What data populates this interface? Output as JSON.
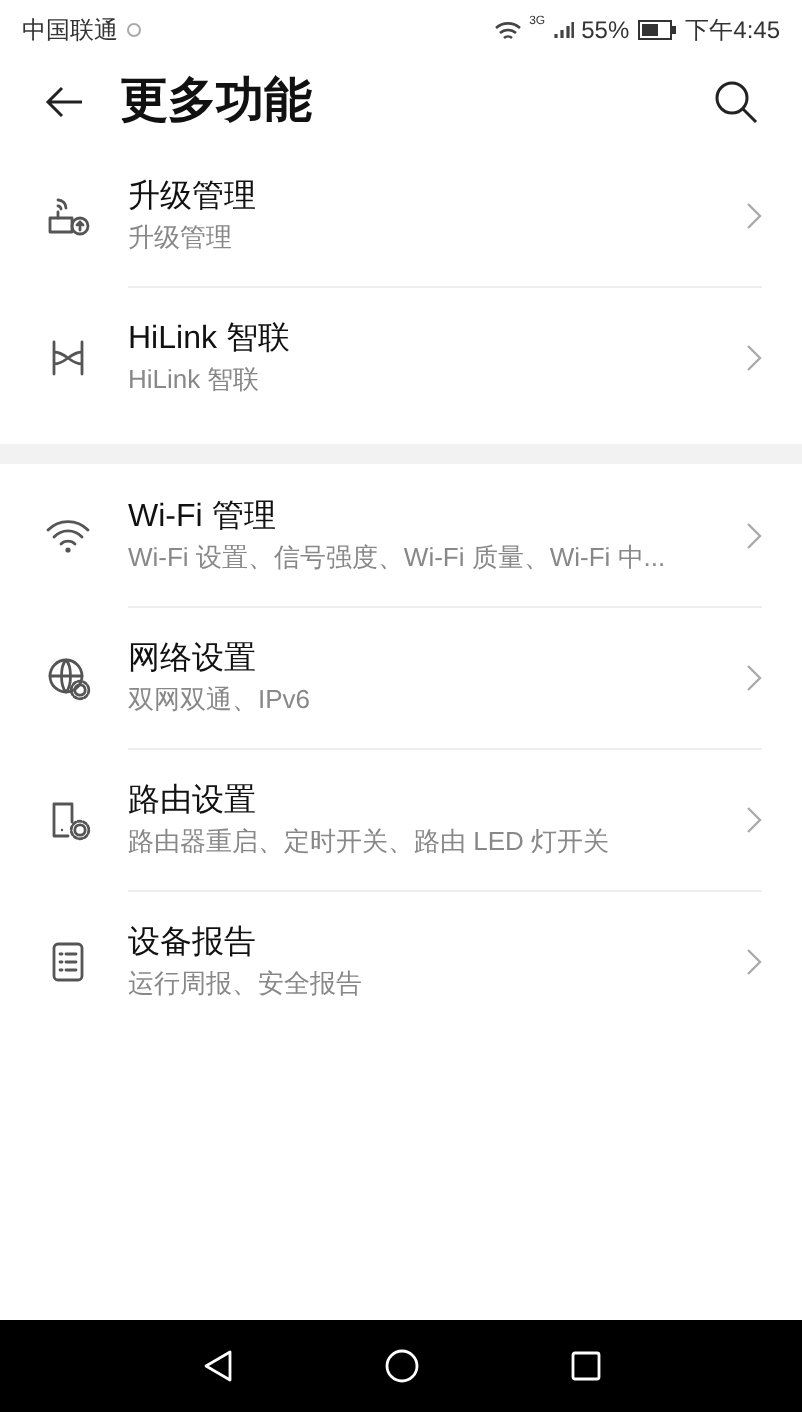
{
  "status_bar": {
    "carrier": "中国联通",
    "network": "3G",
    "battery": "55%",
    "time": "下午4:45"
  },
  "header": {
    "title": "更多功能"
  },
  "sections": [
    {
      "items": [
        {
          "kind": "router-upgrade",
          "title": "升级管理",
          "subtitle": "升级管理"
        },
        {
          "kind": "hilink",
          "title": "HiLink 智联",
          "subtitle": "HiLink 智联"
        }
      ]
    },
    {
      "items": [
        {
          "kind": "wifi",
          "title": "Wi-Fi 管理",
          "subtitle": "Wi-Fi 设置、信号强度、Wi-Fi 质量、Wi-Fi 中..."
        },
        {
          "kind": "globe",
          "title": "网络设置",
          "subtitle": "双网双通、IPv6"
        },
        {
          "kind": "device",
          "title": "路由设置",
          "subtitle": "路由器重启、定时开关、路由 LED 灯开关"
        },
        {
          "kind": "report",
          "title": "设备报告",
          "subtitle": "运行周报、安全报告"
        }
      ]
    }
  ]
}
